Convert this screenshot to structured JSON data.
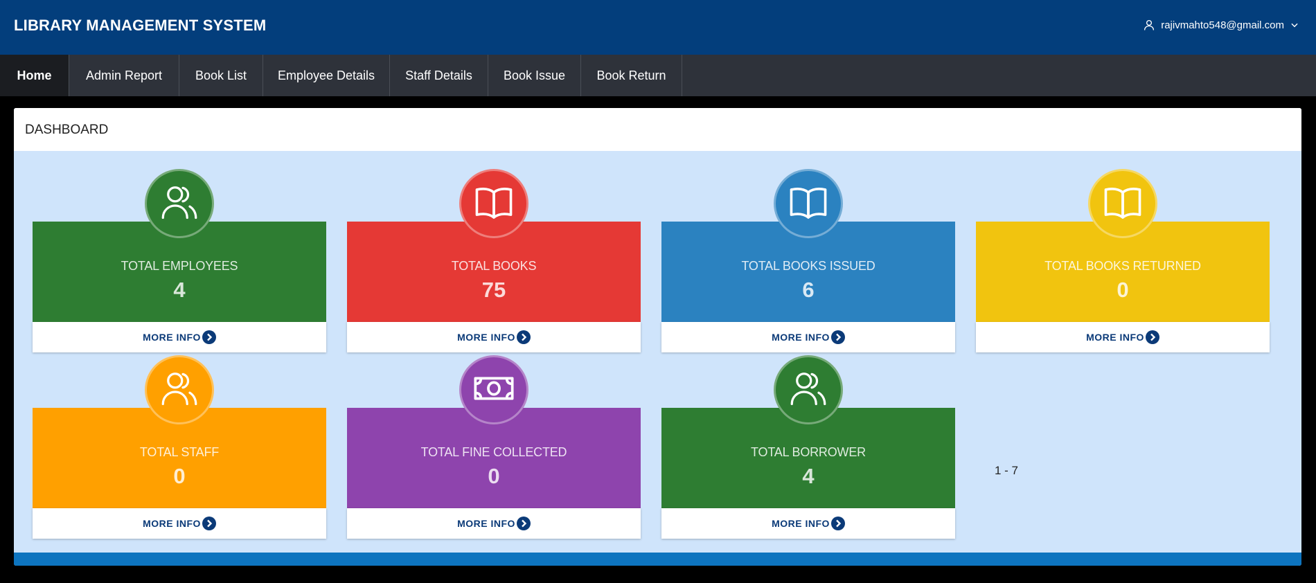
{
  "header": {
    "app_title": "LIBRARY MANAGEMENT SYSTEM",
    "user_email": "rajivmahto548@gmail.com"
  },
  "nav": {
    "items": [
      {
        "label": "Home",
        "active": true
      },
      {
        "label": "Admin Report"
      },
      {
        "label": "Book List"
      },
      {
        "label": "Employee Details"
      },
      {
        "label": "Staff Details"
      },
      {
        "label": "Book Issue"
      },
      {
        "label": "Book Return"
      }
    ]
  },
  "dashboard": {
    "title": "DASHBOARD",
    "more_info_label": "MORE INFO",
    "cards": [
      {
        "label": "TOTAL EMPLOYEES",
        "value": "4",
        "icon": "users-icon",
        "color": "#2e7d32"
      },
      {
        "label": "TOTAL BOOKS",
        "value": "75",
        "icon": "book-open-icon",
        "color": "#e53935"
      },
      {
        "label": "TOTAL BOOKS ISSUED",
        "value": "6",
        "icon": "book-open-icon",
        "color": "#2b82c0"
      },
      {
        "label": "TOTAL BOOKS RETURNED",
        "value": "0",
        "icon": "book-open-icon",
        "color": "#f1c40f"
      },
      {
        "label": "TOTAL STAFF",
        "value": "0",
        "icon": "users-icon",
        "color": "#ffa000"
      },
      {
        "label": "TOTAL FINE COLLECTED",
        "value": "0",
        "icon": "money-icon",
        "color": "#8e44ad"
      },
      {
        "label": "TOTAL BORROWER",
        "value": "4",
        "icon": "users-icon",
        "color": "#2e7d32"
      }
    ],
    "pager_text": "1 - 7"
  }
}
